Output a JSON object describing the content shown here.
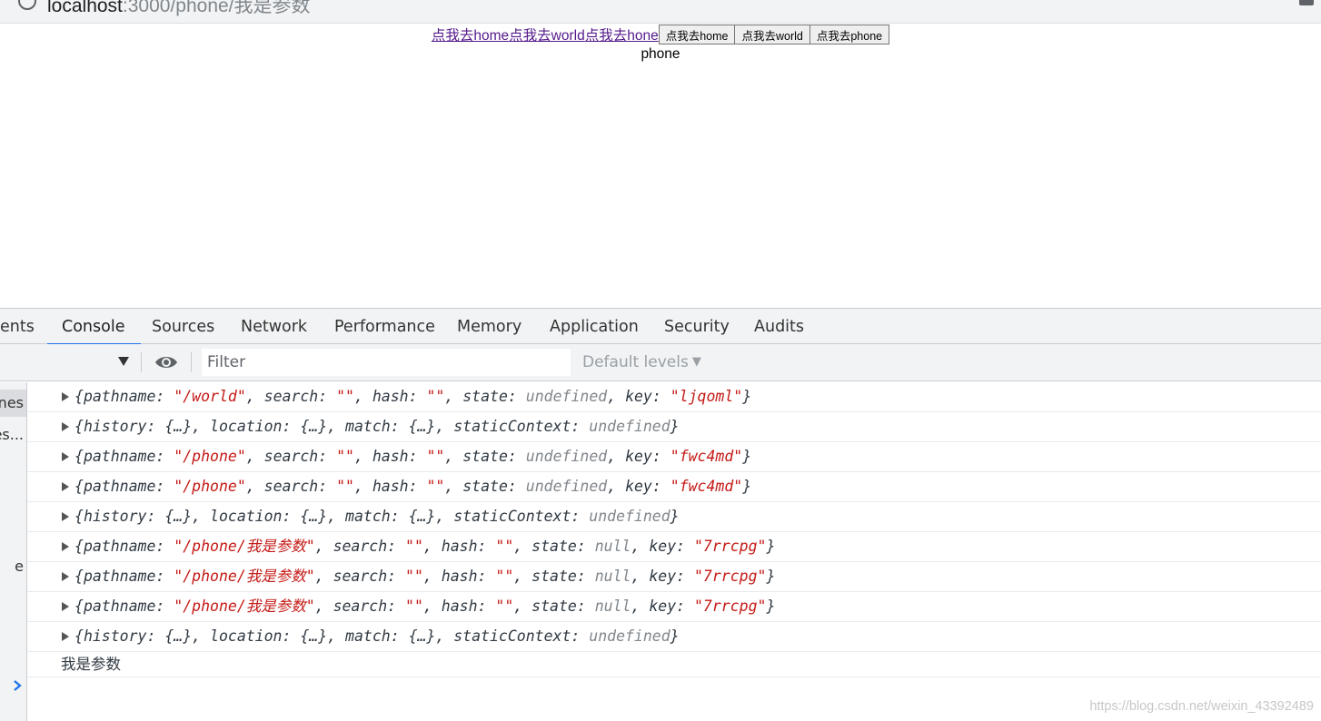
{
  "browser": {
    "url_host": "localhost",
    "url_rest": ":3000/phone/我是参数"
  },
  "page": {
    "links": [
      "点我去home",
      "点我去world",
      "点我去hone"
    ],
    "buttons": [
      "点我去home",
      "点我去world",
      "点我去phone"
    ],
    "content_text": "phone"
  },
  "devtools": {
    "tabs": [
      "ents",
      "Console",
      "Sources",
      "Network",
      "Performance",
      "Memory",
      "Application",
      "Security",
      "Audits"
    ],
    "active_tab": "Console",
    "toolbar": {
      "filter_placeholder": "Filter",
      "levels_label": "Default levels"
    },
    "sidebar_items": [
      "nes",
      "es...",
      "e"
    ],
    "console_rows": [
      {
        "type": "location",
        "pathname": "\"/world\"",
        "search": "\"\"",
        "hash": "\"\"",
        "state": "undefined",
        "key": "\"ljqoml\""
      },
      {
        "type": "props",
        "history": "{…}",
        "location": "{…}",
        "match": "{…}",
        "staticContext": "undefined"
      },
      {
        "type": "location",
        "pathname": "\"/phone\"",
        "search": "\"\"",
        "hash": "\"\"",
        "state": "undefined",
        "key": "\"fwc4md\""
      },
      {
        "type": "location",
        "pathname": "\"/phone\"",
        "search": "\"\"",
        "hash": "\"\"",
        "state": "undefined",
        "key": "\"fwc4md\""
      },
      {
        "type": "props",
        "history": "{…}",
        "location": "{…}",
        "match": "{…}",
        "staticContext": "undefined"
      },
      {
        "type": "location",
        "pathname": "\"/phone/我是参数\"",
        "search": "\"\"",
        "hash": "\"\"",
        "state": "null",
        "key": "\"7rrcpg\""
      },
      {
        "type": "location",
        "pathname": "\"/phone/我是参数\"",
        "search": "\"\"",
        "hash": "\"\"",
        "state": "null",
        "key": "\"7rrcpg\""
      },
      {
        "type": "location",
        "pathname": "\"/phone/我是参数\"",
        "search": "\"\"",
        "hash": "\"\"",
        "state": "null",
        "key": "\"7rrcpg\""
      },
      {
        "type": "props",
        "history": "{…}",
        "location": "{…}",
        "match": "{…}",
        "staticContext": "undefined"
      }
    ],
    "plain_log": "我是参数",
    "labels": {
      "pathname": "pathname",
      "search": "search",
      "hash": "hash",
      "state": "state",
      "key": "key",
      "history": "history",
      "location": "location",
      "match": "match",
      "staticContext": "staticContext"
    }
  },
  "watermark": "https://blog.csdn.net/weixin_43392489",
  "colors": {
    "string": "#c41a16",
    "undefined": "#80868b",
    "link_visited": "#551a8b",
    "tab_underline": "#1a73e8",
    "prompt": "#1a73e8"
  },
  "icons": {
    "info": "info-icon",
    "eye": "eye-icon",
    "context_dropdown": "caret-down-icon",
    "expand": "expand-triangle-icon",
    "prompt": "chevron-right-icon"
  }
}
